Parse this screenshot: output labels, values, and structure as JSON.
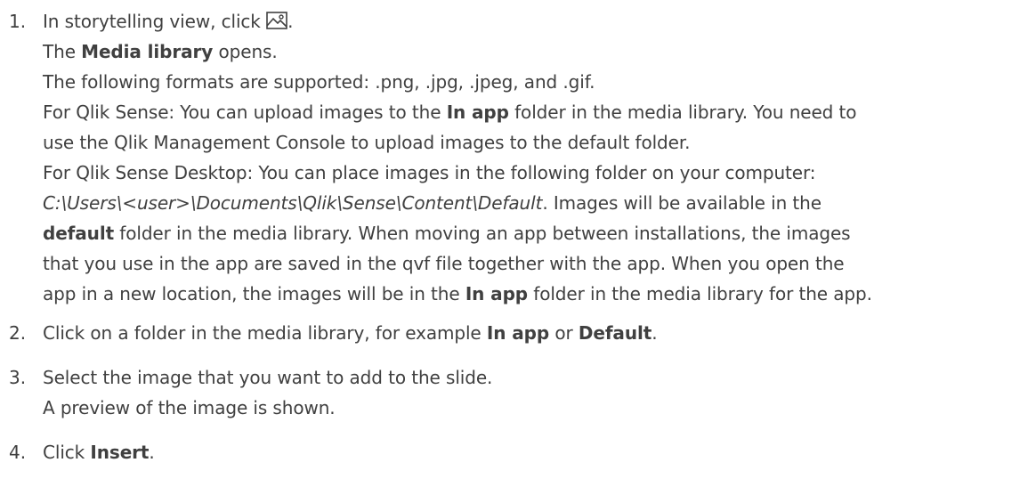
{
  "steps": [
    {
      "number": "1.",
      "lines": [
        {
          "a": "In storytelling view, click ",
          "b": "",
          "c": "."
        },
        {
          "a": "The ",
          "b": "Media library",
          "c": " opens."
        },
        {
          "a": "The following formats are supported: .png, .jpg, .jpeg, and .gif.",
          "b": "",
          "c": ""
        },
        {
          "a": "For Qlik Sense: You can upload images to the ",
          "b": "In app",
          "c": " folder in the media library. You need to"
        },
        {
          "a": "use the Qlik Management Console to upload images to the default folder.",
          "b": "",
          "c": ""
        },
        {
          "a": "For Qlik Sense Desktop: You can place images in the following folder on your computer:",
          "b": "",
          "c": ""
        },
        {
          "a": "",
          "i": "C:\\Users\\<user>\\Documents\\Qlik\\Sense\\Content\\Default",
          "c": ". Images will be available in the"
        },
        {
          "a": "",
          "b": "default",
          "c": " folder in the media library. When moving an app between installations, the images"
        },
        {
          "a": "that you use in the app are saved in the qvf file together with the app. When you open the",
          "b": "",
          "c": ""
        },
        {
          "a": "app in a new location, the images will be in the ",
          "b": "In app",
          "c": " folder in the media library for the app."
        }
      ]
    },
    {
      "number": "2.",
      "lines": [
        {
          "a": "Click on a folder in the media library, for example ",
          "b": "In app",
          "c": " or ",
          "b2": "Default",
          "c2": "."
        }
      ]
    },
    {
      "number": "3.",
      "lines": [
        {
          "a": "Select the image that you want to add to the slide.",
          "b": "",
          "c": ""
        },
        {
          "a": "A preview of the image is shown.",
          "b": "",
          "c": ""
        }
      ]
    },
    {
      "number": "4.",
      "lines": [
        {
          "a": "Click ",
          "b": "Insert",
          "c": "."
        }
      ]
    }
  ],
  "icons": {
    "media_library": "image-icon"
  }
}
